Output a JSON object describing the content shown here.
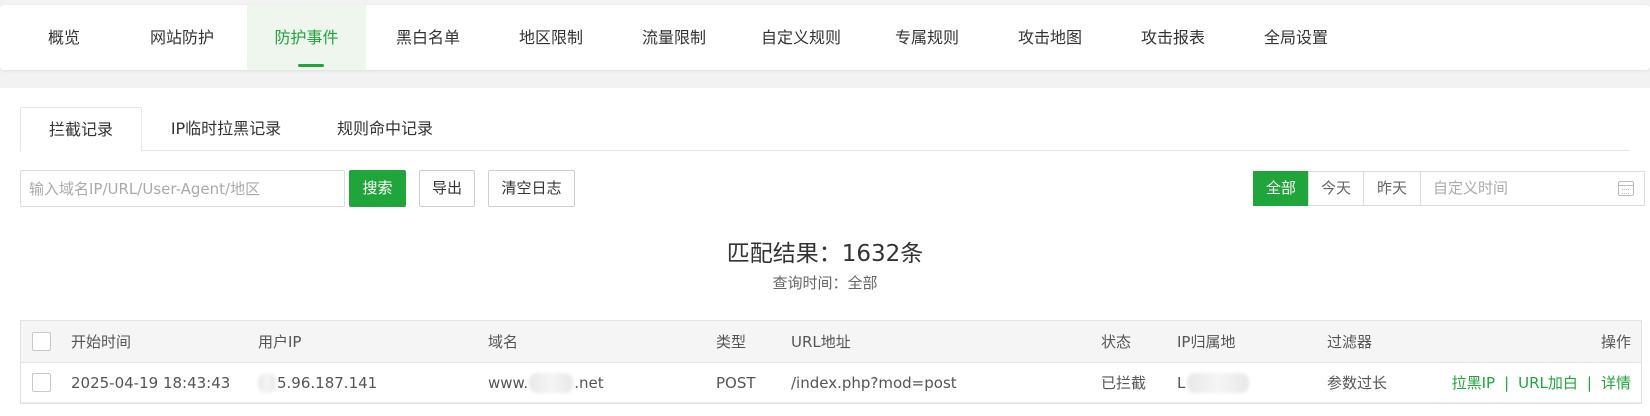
{
  "topnav": {
    "tabs": [
      {
        "label": "概览"
      },
      {
        "label": "网站防护"
      },
      {
        "label": "防护事件",
        "active": true
      },
      {
        "label": "黑白名单"
      },
      {
        "label": "地区限制"
      },
      {
        "label": "流量限制"
      },
      {
        "label": "自定义规则"
      },
      {
        "label": "专属规则"
      },
      {
        "label": "攻击地图"
      },
      {
        "label": "攻击报表"
      },
      {
        "label": "全局设置"
      }
    ]
  },
  "subtabs": [
    {
      "label": "拦截记录",
      "active": true
    },
    {
      "label": "IP临时拉黑记录"
    },
    {
      "label": "规则命中记录"
    }
  ],
  "toolbar": {
    "search_placeholder": "输入域名IP/URL/User-Agent/地区",
    "search_label": "搜索",
    "export_label": "导出",
    "clear_label": "清空日志"
  },
  "date_filter": {
    "options": [
      "全部",
      "今天",
      "昨天"
    ],
    "selected": "全部",
    "custom_placeholder": "自定义时间"
  },
  "result": {
    "count_text": "匹配结果：1632条",
    "time_text": "查询时间：全部"
  },
  "table": {
    "headers": {
      "start_time": "开始时间",
      "user_ip": "用户IP",
      "domain": "域名",
      "type": "类型",
      "url": "URL地址",
      "status": "状态",
      "ip_location": "IP归属地",
      "filter": "过滤器",
      "actions": "操作"
    },
    "rows": [
      {
        "start_time": "2025-04-19 18:43:43",
        "user_ip_visible": "5.96.187.141",
        "domain_prefix": "www.",
        "domain_suffix": ".net",
        "type": "POST",
        "url": "/index.php?mod=post",
        "status": "已拦截",
        "ip_location_visible": "L",
        "filter": "参数过长",
        "action_blacklist": "拉黑IP",
        "action_url_whitelist": "URL加白",
        "action_detail": "详情",
        "separator": "|"
      }
    ]
  },
  "colors": {
    "accent": "#20a53a",
    "active_tab_bg": "#eef6ee"
  }
}
